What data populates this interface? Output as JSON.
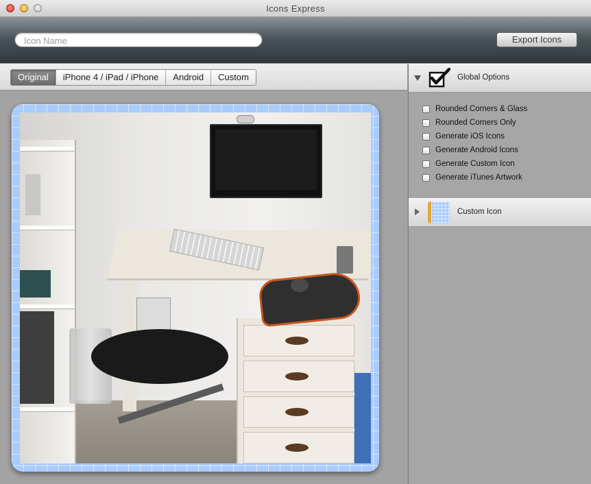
{
  "window": {
    "title": "Icons Express"
  },
  "toolbar": {
    "search_placeholder": "Icon Name",
    "search_value": "",
    "export_label": "Export Icons"
  },
  "tabs": [
    {
      "label": "Original",
      "active": true
    },
    {
      "label": "iPhone 4 / iPad / iPhone",
      "active": false
    },
    {
      "label": "Android",
      "active": false
    },
    {
      "label": "Custom",
      "active": false
    }
  ],
  "preview": {
    "icon_name": "checkbox-check-icon",
    "frame_color": "#a9cbff"
  },
  "global_options": {
    "title": "Global Options",
    "icon": "checkmark-box-icon",
    "expanded": true,
    "options": [
      {
        "label": "Rounded Corners & Glass",
        "checked": false
      },
      {
        "label": "Rounded Corners Only",
        "checked": false
      },
      {
        "label": "Generate iOS Icons",
        "checked": false
      },
      {
        "label": "Generate Android Icons",
        "checked": false
      },
      {
        "label": "Generate Custom Icon",
        "checked": false
      },
      {
        "label": "Generate iTunes Artwork",
        "checked": false
      }
    ]
  },
  "custom_icon": {
    "title": "Custom Icon",
    "icon": "grid-thumbnail-icon",
    "expanded": false
  }
}
